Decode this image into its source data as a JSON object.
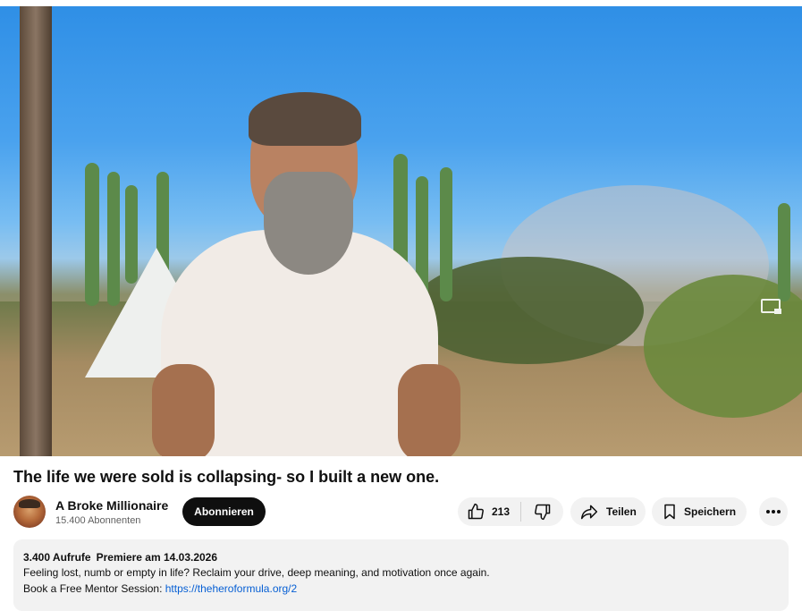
{
  "video": {
    "title": "The life we were sold is collapsing- so I built a new one.",
    "pip_icon": "miniplayer-icon"
  },
  "channel": {
    "name": "A Broke Millionaire",
    "subscribers": "15.400 Abonnenten",
    "subscribe_label": "Abonnieren"
  },
  "actions": {
    "like_count": "213",
    "like_icon": "thumbs-up-icon",
    "dislike_icon": "thumbs-down-icon",
    "share_label": "Teilen",
    "share_icon": "share-arrow-icon",
    "save_label": "Speichern",
    "save_icon": "bookmark-icon",
    "more_icon": "more-horizontal-icon"
  },
  "description": {
    "views": "3.400 Aufrufe",
    "premiere": "Premiere am 14.03.2026",
    "line1": "Feeling lost, numb or empty in life? Reclaim your drive, deep meaning, and motivation once again.",
    "line2_prefix": "Book a Free Mentor Session: ",
    "link": "https://theheroformula.org/2"
  },
  "colors": {
    "subscribe_bg": "#0f0f0f",
    "pill_bg": "#f2f2f2",
    "link": "#065fd4"
  }
}
